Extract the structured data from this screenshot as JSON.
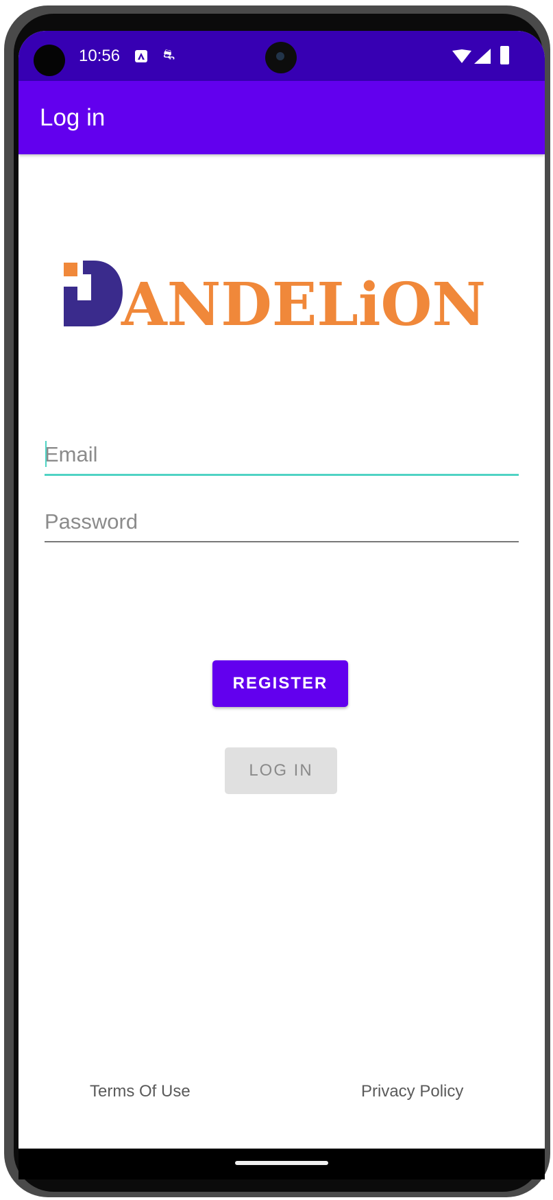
{
  "status_bar": {
    "time": "10:56",
    "notification_icons": [
      "accessibility-icon",
      "bug-icon"
    ],
    "system_icons": [
      "wifi-icon",
      "cell-signal-icon",
      "battery-icon"
    ]
  },
  "app_bar": {
    "title": "Log in",
    "color": "#6200ee"
  },
  "logo": {
    "text": "ANDELiON",
    "mark": "D"
  },
  "form": {
    "email_placeholder": "Email",
    "email_value": "",
    "password_placeholder": "Password",
    "password_value": ""
  },
  "buttons": {
    "register_label": "REGISTER",
    "login_label": "LOG IN"
  },
  "footer": {
    "terms_label": "Terms Of Use",
    "privacy_label": "Privacy Policy"
  },
  "colors": {
    "status_bar": "#3700b3",
    "primary": "#6200ee",
    "accent": "#4fd3c4",
    "logo_orange": "#f0883a",
    "logo_purple": "#3a2b8c"
  }
}
